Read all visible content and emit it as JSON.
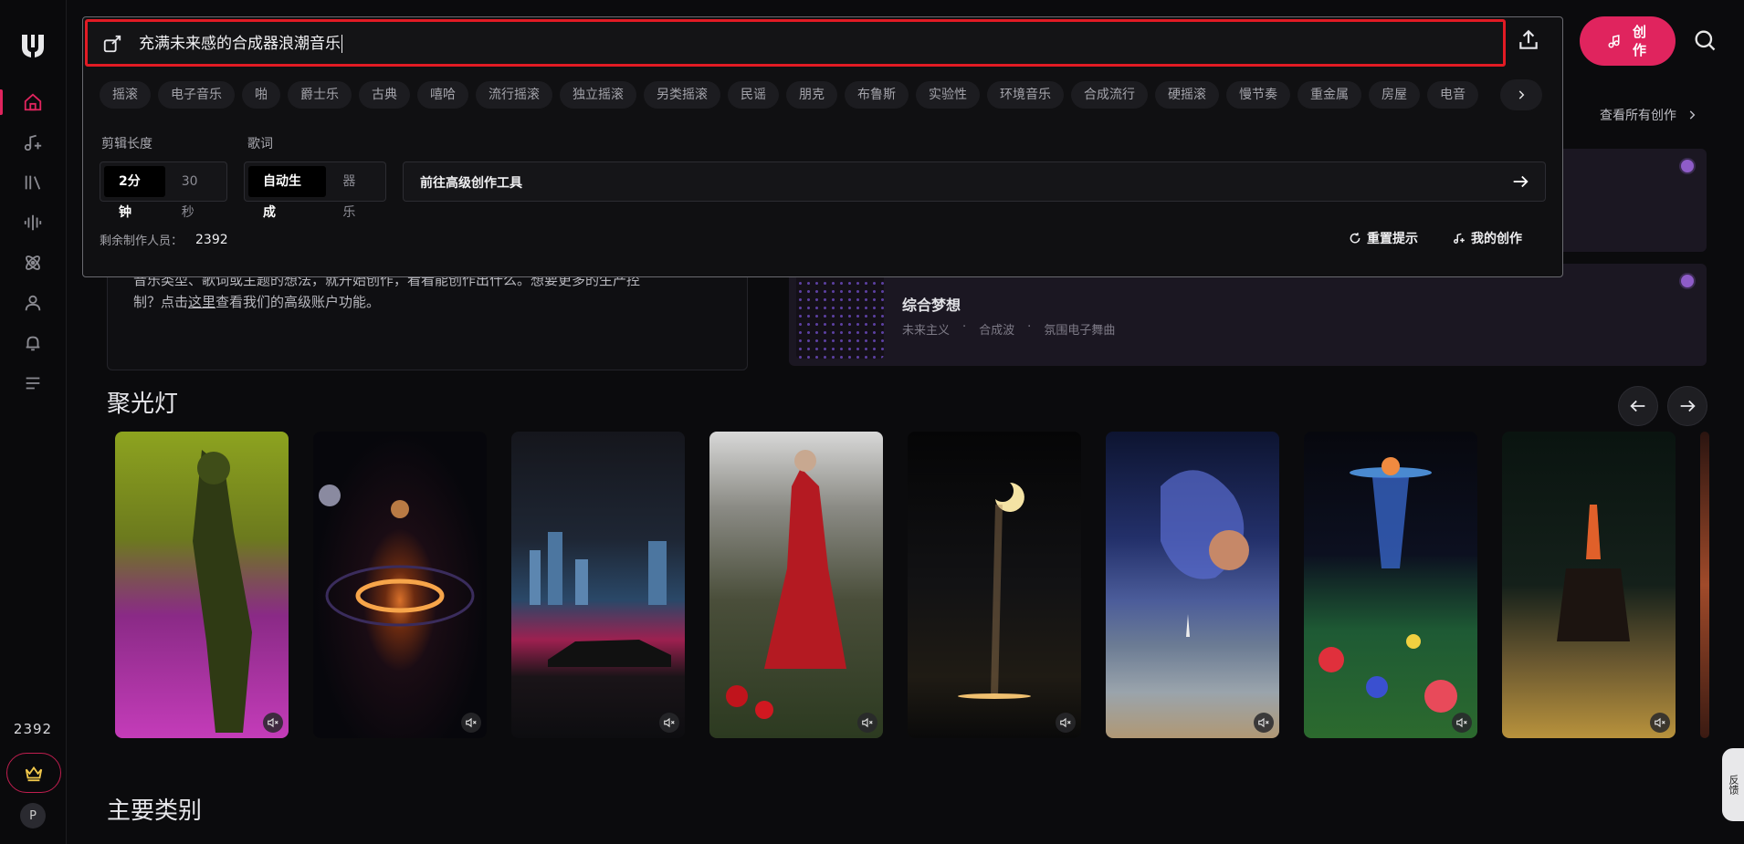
{
  "sidebar": {
    "credits": "2392",
    "avatar_letter": "P",
    "items": [
      {
        "name": "home-icon"
      },
      {
        "name": "music-create-icon"
      },
      {
        "name": "library-icon"
      },
      {
        "name": "waveform-icon"
      },
      {
        "name": "atom-icon"
      },
      {
        "name": "user-icon"
      },
      {
        "name": "bell-icon"
      },
      {
        "name": "menu-icon"
      }
    ]
  },
  "header": {
    "create_label": "创作"
  },
  "popup": {
    "prompt_text": "充满未来感的合成器浪潮音乐",
    "tags": [
      "摇滚",
      "电子音乐",
      "啪",
      "爵士乐",
      "古典",
      "嘻哈",
      "流行摇滚",
      "独立摇滚",
      "另类摇滚",
      "民谣",
      "朋克",
      "布鲁斯",
      "实验性",
      "环境音乐",
      "合成流行",
      "硬摇滚",
      "慢节奏",
      "重金属",
      "房屋",
      "电音"
    ],
    "clip_length_label": "剪辑长度",
    "clip_options": [
      "2分钟",
      "30秒"
    ],
    "lyrics_label": "歌词",
    "lyrics_options": [
      "自动生成",
      "器乐"
    ],
    "advanced_label": "前往高级创作工具",
    "remaining_label": "剩余制作人员：",
    "remaining_value": "2392",
    "reset_label": "重置提示",
    "my_creations_label": "我的创作"
  },
  "recent": {
    "view_all_label": "查看所有创作",
    "song": {
      "title": "综合梦想",
      "tags": [
        "未来主义",
        "·",
        "合成波",
        "·",
        "氛围电子舞曲"
      ]
    }
  },
  "info": {
    "line1": "音乐类型、歌词或主题的想法，就开始创作，看看能创作出什么。想要更多的生产控",
    "line2_pre": "制？点击",
    "line2_link": "这里",
    "line2_post": "查看我们的高级账户功能。"
  },
  "spotlight": {
    "title": "聚光灯"
  },
  "categories": {
    "title": "主要类别"
  },
  "side_tab_label": "反馈",
  "colors": {
    "accent": "#e0245e",
    "highlight_border": "#e21b24",
    "purple_dot": "#8e5cc8"
  }
}
